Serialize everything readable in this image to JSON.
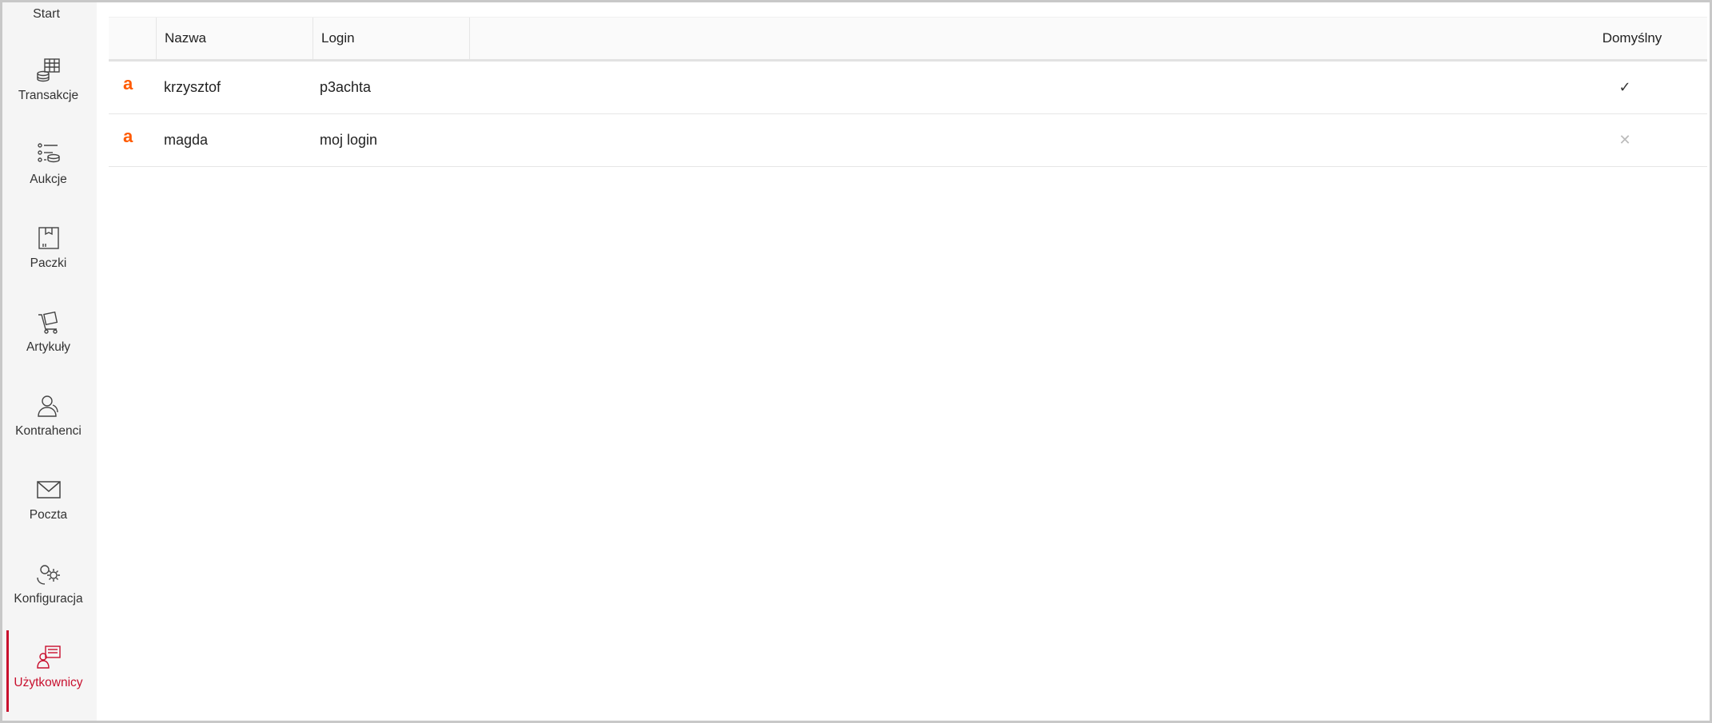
{
  "sidebar": {
    "start_label": "Start",
    "items": [
      {
        "label": "Transakcje",
        "icon": "transactions-icon"
      },
      {
        "label": "Aukcje",
        "icon": "auctions-icon"
      },
      {
        "label": "Paczki",
        "icon": "package-icon"
      },
      {
        "label": "Artykuły",
        "icon": "articles-icon"
      },
      {
        "label": "Kontrahenci",
        "icon": "contractors-icon"
      },
      {
        "label": "Poczta",
        "icon": "mail-icon"
      },
      {
        "label": "Konfiguracja",
        "icon": "config-gear-icon"
      },
      {
        "label": "Użytkownicy",
        "icon": "users-icon",
        "active": true
      }
    ],
    "active_color": "#c8102e"
  },
  "grid": {
    "columns": {
      "name": "Nazwa",
      "login": "Login",
      "default": "Domyślny"
    },
    "rows": [
      {
        "logo": "a",
        "name": "krzysztof",
        "login": "p3achta",
        "default_mark": "✓"
      },
      {
        "logo": "a",
        "name": "magda",
        "login": "moj login",
        "default_mark": "✕"
      }
    ],
    "logo_color": "#ff5a00"
  }
}
